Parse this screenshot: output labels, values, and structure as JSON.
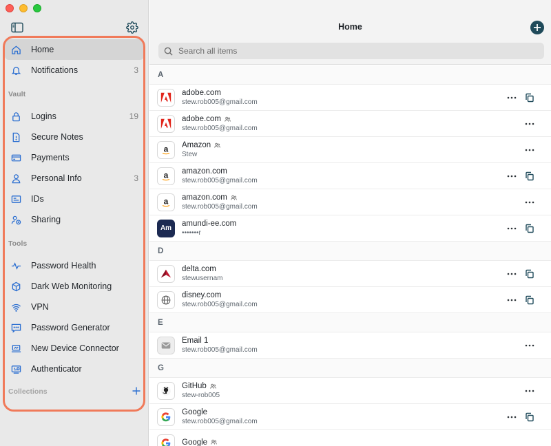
{
  "sidebar": {
    "nav": {
      "home": "Home",
      "notifications": "Notifications",
      "notifications_count": "3"
    },
    "vault_label": "Vault",
    "vault": {
      "logins": "Logins",
      "logins_count": "19",
      "secure_notes": "Secure Notes",
      "payments": "Payments",
      "personal_info": "Personal Info",
      "personal_info_count": "3",
      "ids": "IDs",
      "sharing": "Sharing"
    },
    "tools_label": "Tools",
    "tools": {
      "password_health": "Password Health",
      "dark_web": "Dark Web Monitoring",
      "vpn": "VPN",
      "password_generator": "Password Generator",
      "new_device": "New Device Connector",
      "authenticator": "Authenticator"
    },
    "collections_label": "Collections"
  },
  "header": {
    "title": "Home",
    "search_placeholder": "Search all items"
  },
  "groups": {
    "a": "A",
    "d": "D",
    "e": "E",
    "g": "G"
  },
  "items": {
    "adobe1": {
      "name": "adobe.com",
      "sub": "stew.rob005@gmail.com"
    },
    "adobe2": {
      "name": "adobe.com",
      "sub": "stew.rob005@gmail.com"
    },
    "amazon1": {
      "name": "Amazon",
      "sub": "Stew"
    },
    "amazon2": {
      "name": "amazon.com",
      "sub": "stew.rob005@gmail.com"
    },
    "amazon3": {
      "name": "amazon.com",
      "sub": "stew.rob005@gmail.com"
    },
    "amundi": {
      "name": "amundi-ee.com",
      "sub": "•••••••r",
      "logo_text": "Am"
    },
    "delta": {
      "name": "delta.com",
      "sub": "stewusernam"
    },
    "disney": {
      "name": "disney.com",
      "sub": "stew.rob005@gmail.com"
    },
    "email1": {
      "name": "Email 1",
      "sub": "stew.rob005@gmail.com"
    },
    "github": {
      "name": "GitHub",
      "sub": "stew-rob005"
    },
    "google1": {
      "name": "Google",
      "sub": "stew.rob005@gmail.com"
    },
    "google2": {
      "name": "Google",
      "sub": ""
    }
  },
  "colors": {
    "accent": "#1f4a5a",
    "highlight": "#f07a5a",
    "nav_icon": "#2c6fd1"
  }
}
